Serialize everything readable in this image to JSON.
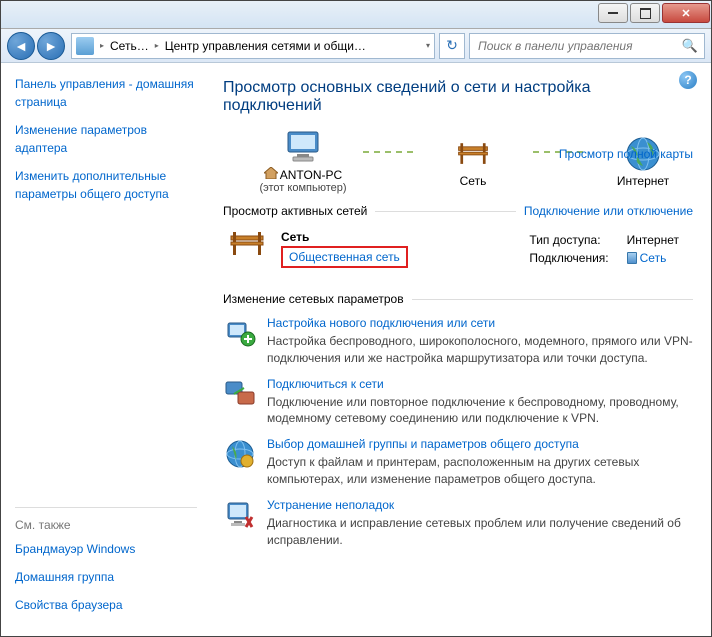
{
  "breadcrumb": {
    "item1": "Сеть…",
    "item2": "Центр управления сетями и общи…"
  },
  "search": {
    "placeholder": "Поиск в панели управления"
  },
  "sidebar": {
    "home": "Панель управления - домашняя страница",
    "adapter": "Изменение параметров адаптера",
    "sharing": "Изменить дополнительные параметры общего доступа"
  },
  "seealso": {
    "hdr": "См. также",
    "firewall": "Брандмауэр Windows",
    "homegroup": "Домашняя группа",
    "browser": "Свойства браузера"
  },
  "main": {
    "title": "Просмотр основных сведений о сети и настройка подключений",
    "fullmap": "Просмотр полной карты",
    "pc": "ANTON-PC",
    "pcsub": "(этот компьютер)",
    "net": "Сеть",
    "internet": "Интернет"
  },
  "active": {
    "hdr": "Просмотр активных сетей",
    "connectlink": "Подключение или отключение",
    "netname": "Сеть",
    "profile": "Общественная сеть",
    "accesslabel": "Тип доступа:",
    "accessval": "Интернет",
    "connlabel": "Подключения:",
    "connval": "Сеть"
  },
  "change": {
    "hdr": "Изменение сетевых параметров"
  },
  "tasks": [
    {
      "title": "Настройка нового подключения или сети",
      "desc": "Настройка беспроводного, широкополосного, модемного, прямого или VPN-подключения или же настройка маршрутизатора или точки доступа."
    },
    {
      "title": "Подключиться к сети",
      "desc": "Подключение или повторное подключение к беспроводному, проводному, модемному сетевому соединению или подключение к VPN."
    },
    {
      "title": "Выбор домашней группы и параметров общего доступа",
      "desc": "Доступ к файлам и принтерам, расположенным на других сетевых компьютерах, или изменение параметров общего доступа."
    },
    {
      "title": "Устранение неполадок",
      "desc": "Диагностика и исправление сетевых проблем или получение сведений об исправлении."
    }
  ]
}
